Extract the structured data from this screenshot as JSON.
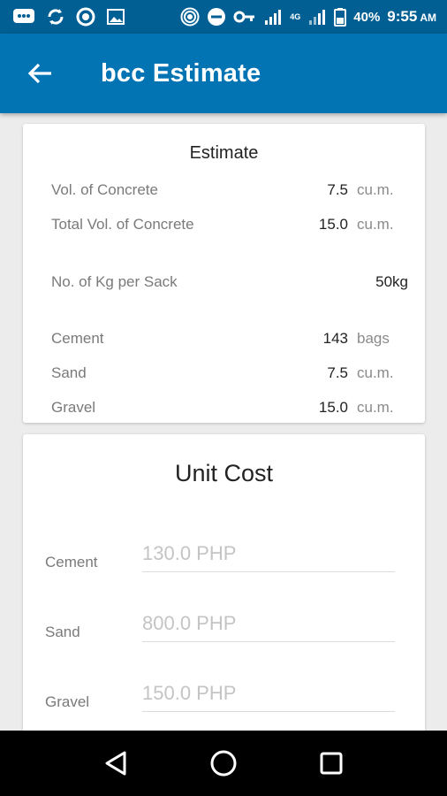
{
  "status_bar": {
    "network_badge": "4G",
    "battery": "40%",
    "time": "9:55",
    "ampm": "AM",
    "icons": [
      "messages-icon",
      "sync-icon",
      "circular-app-icon",
      "image-icon",
      "hotspot-icon",
      "do-not-disturb-icon",
      "key-icon",
      "signal-icon",
      "signal-icon-2",
      "battery-icon"
    ]
  },
  "app_bar": {
    "title": "bcc Estimate",
    "back_icon": "arrow-left-icon"
  },
  "estimate": {
    "title": "Estimate",
    "rows": [
      {
        "label": "Vol. of Concrete",
        "value": "7.5",
        "unit": "cu.m."
      },
      {
        "label": "Total Vol. of Concrete",
        "value": "15.0",
        "unit": "cu.m."
      },
      {
        "label": "No. of Kg per Sack",
        "value": "50kg",
        "unit": ""
      },
      {
        "label": "Cement",
        "value": "143",
        "unit": "bags"
      },
      {
        "label": "Sand",
        "value": "7.5",
        "unit": "cu.m."
      },
      {
        "label": "Gravel",
        "value": "15.0",
        "unit": "cu.m."
      }
    ]
  },
  "unit_cost": {
    "title": "Unit Cost",
    "fields": [
      {
        "label": "Cement",
        "placeholder": "130.0 PHP",
        "value": ""
      },
      {
        "label": "Sand",
        "placeholder": "800.0 PHP",
        "value": ""
      },
      {
        "label": "Gravel",
        "placeholder": "150.0 PHP",
        "value": ""
      }
    ]
  },
  "nav_bar": {
    "icons": [
      "back-triangle-icon",
      "home-circle-icon",
      "recents-square-icon"
    ]
  },
  "colors": {
    "status_bar": "#015f94",
    "app_bar": "#0274b3",
    "background": "#ececec"
  }
}
